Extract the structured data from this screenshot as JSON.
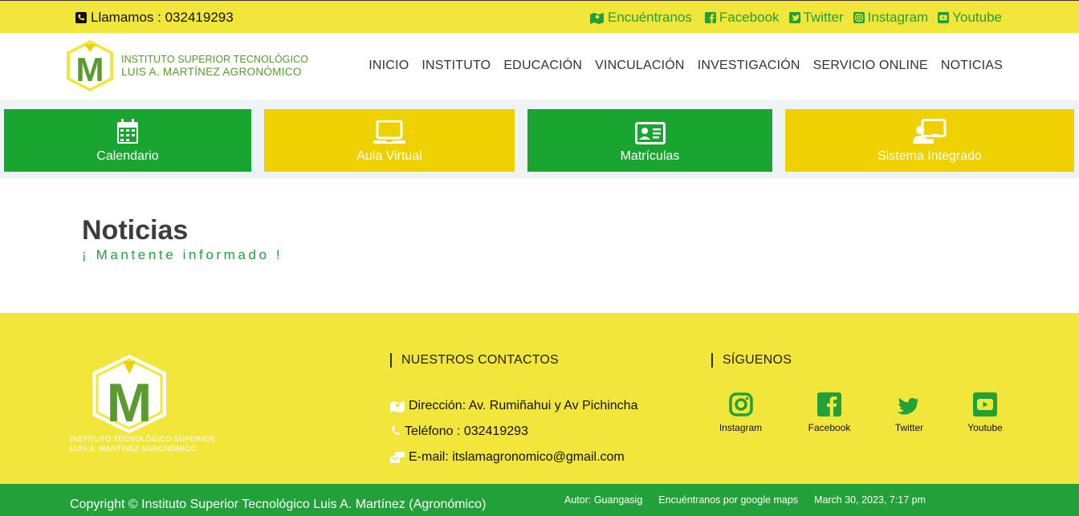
{
  "topbar": {
    "phone": "Llamamos : 032419293",
    "links": [
      {
        "label": "Encuéntranos",
        "icon": "map-icon"
      },
      {
        "label": "Facebook",
        "icon": "facebook-icon"
      },
      {
        "label": "Twitter",
        "icon": "twitter-icon"
      },
      {
        "label": "Instagram",
        "icon": "instagram-icon"
      },
      {
        "label": "Youtube",
        "icon": "youtube-icon"
      }
    ]
  },
  "header": {
    "logo_letter": "M",
    "logo_line1": "INSTITUTO SUPERIOR TECNOLÓGICO",
    "logo_line2": "LUIS A. MARTÍNEZ AGRONÓMICO",
    "nav": [
      "INICIO",
      "INSTITUTO",
      "EDUCACIÓN",
      "VINCULACIÓN",
      "INVESTIGACIÓN",
      "SERVICIO ONLINE",
      "NOTICIAS"
    ]
  },
  "tiles": [
    {
      "label": "Calendario",
      "icon": "calendar-icon",
      "color": "#18a631"
    },
    {
      "label": "Aula Virtual",
      "icon": "laptop-icon",
      "color": "#efd000"
    },
    {
      "label": "Matrículas",
      "icon": "id-card-icon",
      "color": "#18a631"
    },
    {
      "label": "Sistema Integrado",
      "icon": "presenter-icon",
      "color": "#efd000"
    }
  ],
  "main": {
    "title": "Noticias",
    "subtitle": "¡ Mantente informado !"
  },
  "footer": {
    "logo_letter": "M",
    "logo_caption_1": "INSTITUTO TECNOLÓGICO SUPERIOR",
    "logo_caption_2": "LUIS A. MARTÍNEZ AGRONÓMICO",
    "contacts_heading": "NUESTROS CONTACTOS",
    "address": "Dirección: Av. Rumiñahui y Av Pichincha",
    "phone": "Teléfono : 032419293",
    "email": "E-mail: itslamagronomico@gmail.com",
    "social_heading": "SÍGUENOS",
    "social": [
      {
        "label": "Instagram",
        "icon": "instagram-icon"
      },
      {
        "label": "Facebook",
        "icon": "facebook-icon"
      },
      {
        "label": "Twitter",
        "icon": "twitter-icon"
      },
      {
        "label": "Youtube",
        "icon": "youtube-icon"
      }
    ]
  },
  "bottombar": {
    "copyright": "Copyright © Instituto Superior Tecnológico Luis A. Martínez (Agronómico)",
    "author": "Autor: Guangasig",
    "maps": "Encuéntranos por google maps",
    "date": "March 30, 2023, 7:17 pm"
  },
  "colors": {
    "yellow": "#f2e63a",
    "green": "#22a13a",
    "tile_green": "#18a631",
    "tile_yellow": "#efd000"
  }
}
